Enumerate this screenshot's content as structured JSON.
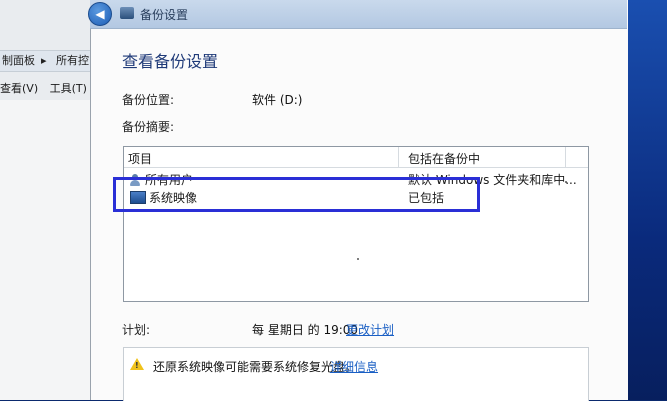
{
  "background_window": {
    "address_items": [
      "制面板",
      "所有控"
    ],
    "menu_items": [
      "查看(V)",
      "工具(T)"
    ]
  },
  "dialog": {
    "title": "备份设置",
    "heading": "查看备份设置",
    "backup_location_label": "备份位置:",
    "backup_location_value": "软件 (D:)",
    "backup_summary_label": "备份摘要:",
    "table": {
      "columns": [
        "项目",
        "包括在备份中"
      ],
      "rows": [
        {
          "icon": "users-icon",
          "item": "所有用户",
          "included": "默认 Windows 文件夹和库中..."
        },
        {
          "icon": "system-image-icon",
          "item": "系统映像",
          "included": "已包括"
        }
      ]
    },
    "schedule_label": "计划:",
    "schedule_value": "每 星期日 的 19:00",
    "change_schedule_link": "更改计划",
    "warning_text": "还原系统映像可能需要系统修复光盘。",
    "details_link": "详细信息"
  },
  "colors": {
    "heading": "#1f3a78",
    "highlight_box": "#2a2fd6",
    "link": "#1a5fc4",
    "desktop": "#0b2a6e"
  }
}
